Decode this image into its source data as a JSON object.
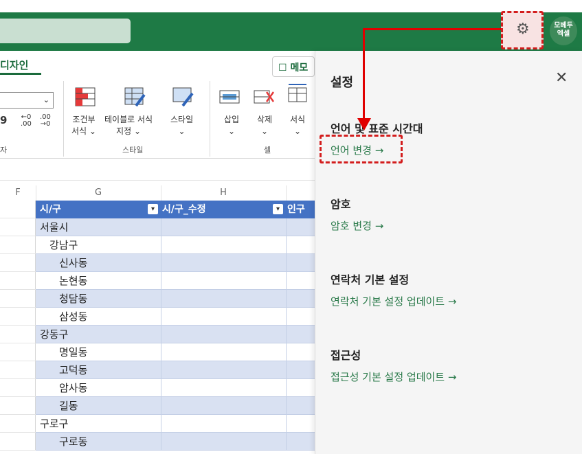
{
  "header": {
    "gear_label": "⚙",
    "avatar_text": "모베두\n엑셀"
  },
  "ribbon": {
    "tab_design": "디자인",
    "memo_label": "메모",
    "font_size_value": "",
    "num_format_glyph": "9",
    "increase_decimal": "←0\n.00",
    "decrease_decimal": ".00\n→0",
    "group_number": "자",
    "conditional_format": "조건부\n서식 ⌄",
    "format_as_table": "테이블로 서식\n지정 ⌄",
    "cell_styles": "스타일\n⌄",
    "group_styles": "스타일",
    "insert": "삽입\n⌄",
    "delete": "삭제\n⌄",
    "format": "서식\n⌄",
    "group_cells": "셀"
  },
  "sheet": {
    "columns": [
      "F",
      "G",
      "H"
    ],
    "headers": [
      "시/구",
      "시/구_수정",
      "인구"
    ],
    "rows": [
      {
        "text": "서울시",
        "indent": 0
      },
      {
        "text": "강남구",
        "indent": 1
      },
      {
        "text": "신사동",
        "indent": 2
      },
      {
        "text": "논현동",
        "indent": 2
      },
      {
        "text": "청담동",
        "indent": 2
      },
      {
        "text": "삼성동",
        "indent": 2
      },
      {
        "text": "강동구",
        "indent": 0
      },
      {
        "text": "명일동",
        "indent": 2
      },
      {
        "text": "고덕동",
        "indent": 2
      },
      {
        "text": "암사동",
        "indent": 2
      },
      {
        "text": "길동",
        "indent": 2
      },
      {
        "text": "구로구",
        "indent": 0
      },
      {
        "text": "구로동",
        "indent": 2
      }
    ]
  },
  "settings": {
    "title": "설정",
    "close": "✕",
    "sections": [
      {
        "title": "언어 및 표준 시간대",
        "link": "언어 변경 →"
      },
      {
        "title": "암호",
        "link": "암호 변경 →"
      },
      {
        "title": "연락처 기본 설정",
        "link": "연락처 기본 설정 업데이트 →"
      },
      {
        "title": "접근성",
        "link": "접근성 기본 설정 업데이트 →"
      }
    ]
  },
  "colors": {
    "header_green": "#1e7a45",
    "link_green": "#2a7a4a",
    "table_header": "#4472c4",
    "band": "#d9e1f2",
    "annotation_red": "#e00000"
  }
}
